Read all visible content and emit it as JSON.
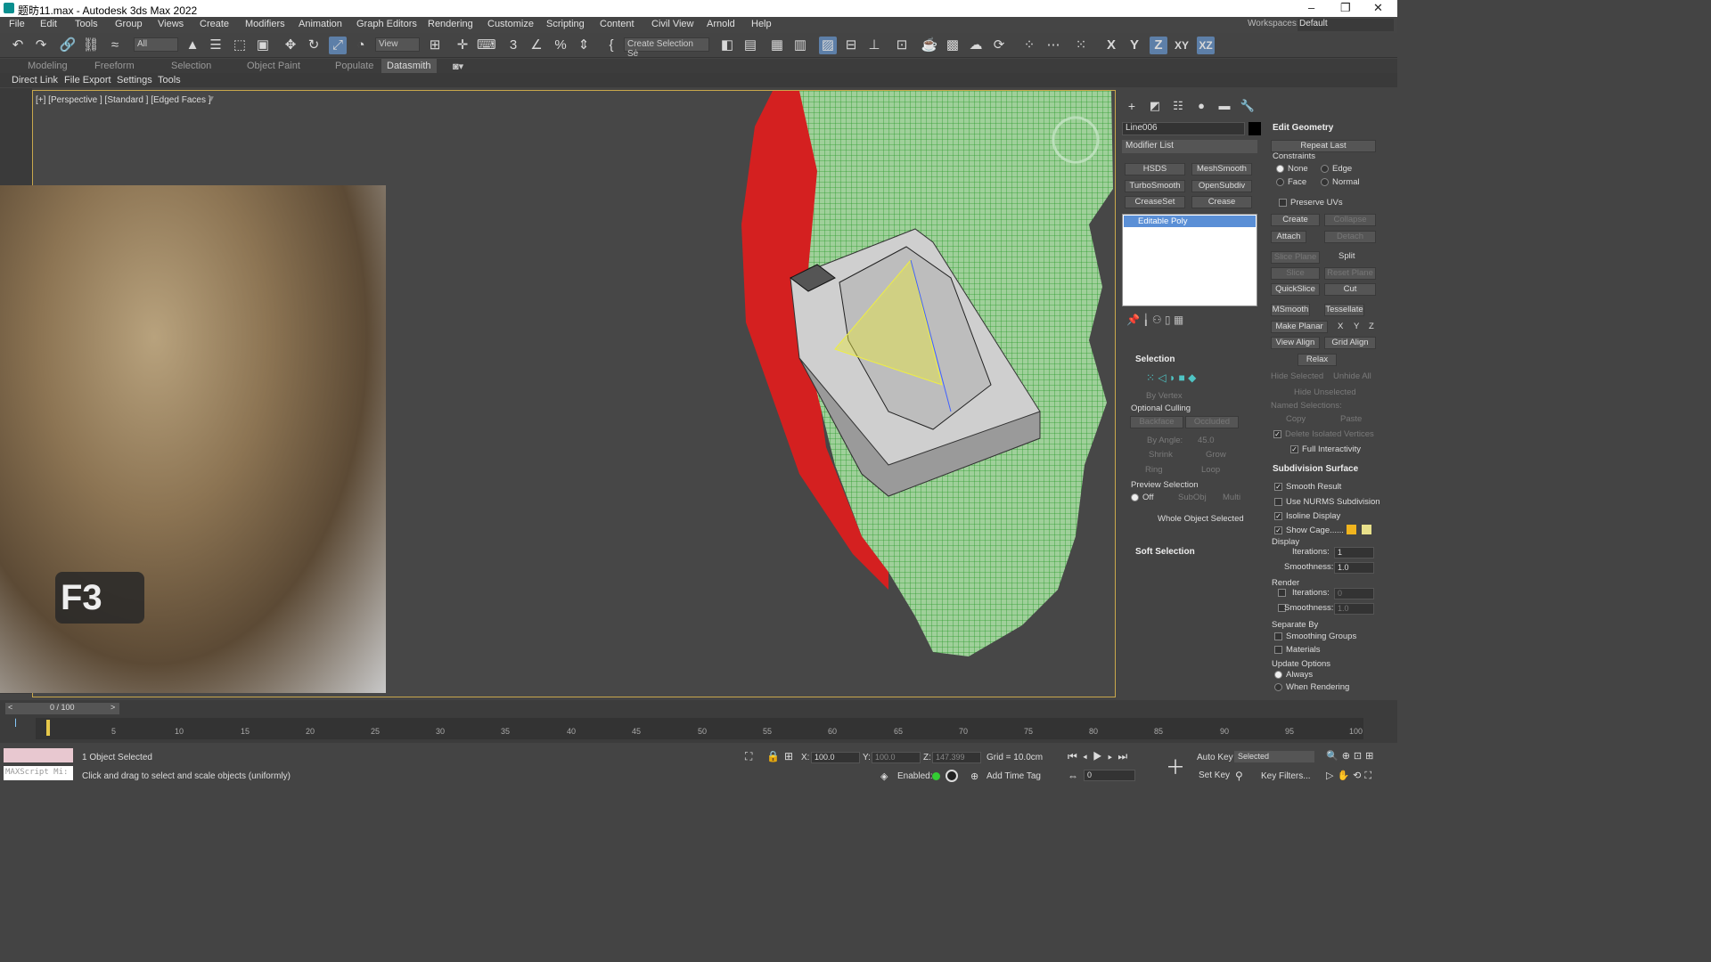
{
  "window": {
    "title": "题昉11.max - Autodesk 3ds Max 2022",
    "minimize": "–",
    "maximize": "❐",
    "close": "✕"
  },
  "menu": [
    "File",
    "Edit",
    "Tools",
    "Group",
    "Views",
    "Create",
    "Modifiers",
    "Animation",
    "Graph Editors",
    "Rendering",
    "Customize",
    "Scripting",
    "Content",
    "Civil View",
    "Arnold",
    "Help"
  ],
  "workspace": {
    "label": "Workspaces:",
    "value": "Default"
  },
  "toolbar": {
    "filter": "All",
    "refcoord": "View",
    "selset": "Create Selection Sė",
    "axes": [
      "X",
      "Y",
      "Z",
      "XY",
      "XZ"
    ]
  },
  "ribbon": {
    "tabs": [
      "Modeling",
      "Freeform",
      "Selection",
      "Object Paint",
      "Populate",
      "Datasmith"
    ],
    "subtabs": [
      "Direct Link",
      "File Export",
      "Settings",
      "Tools"
    ]
  },
  "viewport": {
    "label": "[+] [Perspective ] [Standard ] [Edged Faces ]",
    "overlay_key": "F3"
  },
  "modify": {
    "object_name": "Line006",
    "modifier_list": "Modifier List",
    "mod_buttons": [
      "HSDS",
      "MeshSmooth",
      "TurboSmooth",
      "OpenSubdiv",
      "CreaseSet",
      "Crease"
    ],
    "stack_item": "Editable Poly",
    "selection": {
      "title": "Selection",
      "by_vertex": "By Vertex",
      "ignore_backfacing": "Optional Culling",
      "backface": "Backface",
      "occluded": "Occluded",
      "by_angle": "By Angle:",
      "angle": "45.0",
      "shrink": "Shrink",
      "grow": "Grow",
      "ring": "Ring",
      "loop": "Loop",
      "preview": "Preview Selection",
      "off": "Off",
      "subobj": "SubObj",
      "multi": "Multi",
      "status": "Whole Object Selected"
    },
    "soft_selection": "Soft Selection",
    "edit_geometry": {
      "title": "Edit Geometry",
      "repeat_last": "Repeat Last",
      "constraints": "Constraints",
      "c_none": "None",
      "c_edge": "Edge",
      "c_face": "Face",
      "c_normal": "Normal",
      "preserve_uvs": "Preserve UVs",
      "create": "Create",
      "collapse": "Collapse",
      "attach": "Attach",
      "detach": "Detach",
      "slice_plane": "Slice Plane",
      "split": "Split",
      "slice": "Slice",
      "reset_plane": "Reset Plane",
      "quickslice": "QuickSlice",
      "cut": "Cut",
      "msmooth": "MSmooth",
      "tessellate": "Tessellate",
      "make_planar": "Make Planar",
      "x": "X",
      "y": "Y",
      "z": "Z",
      "view_align": "View Align",
      "grid_align": "Grid Align",
      "relax": "Relax",
      "hide_selected": "Hide Selected",
      "unhide_all": "Unhide All",
      "hide_unselected": "Hide Unselected",
      "named_sel": "Named Selections:",
      "copy": "Copy",
      "paste": "Paste",
      "delete_iso": "Delete Isolated Vertices",
      "full_inter": "Full Interactivity"
    },
    "subdivision": {
      "title": "Subdivision Surface",
      "smooth_result": "Smooth Result",
      "use_nurms": "Use NURMS Subdivision",
      "isoline": "Isoline Display",
      "show_cage": "Show Cage......",
      "display": "Display",
      "iterations": "Iterations:",
      "iter_val": "1",
      "smoothness": "Smoothness:",
      "smooth_val": "1.0",
      "render": "Render",
      "r_iter": "0",
      "r_smooth": "1.0",
      "separate_by": "Separate By",
      "smoothing_groups": "Smoothing Groups",
      "materials": "Materials",
      "update_options": "Update Options",
      "always": "Always",
      "when_rendering": "When Rendering"
    }
  },
  "timeline": {
    "frame": "0 / 100",
    "ticks": [
      "5",
      "10",
      "15",
      "20",
      "25",
      "30",
      "35",
      "40",
      "45",
      "50",
      "55",
      "60",
      "65",
      "70",
      "75",
      "80",
      "85",
      "90",
      "95",
      "100"
    ]
  },
  "status": {
    "selected": "1 Object Selected",
    "prompt": "Click and drag to select and scale objects (uniformly)",
    "maxscript": "MAXScript Mi:",
    "x_label": "X:",
    "x": "100.0",
    "y_label": "Y:",
    "y": "100.0",
    "z_label": "Z:",
    "z": "147.399",
    "grid": "Grid = 10.0cm",
    "enabled": "Enabled:",
    "add_time_tag": "Add Time Tag",
    "auto_key": "Auto Key",
    "set_key": "Set Key",
    "selected_mode": "Selected",
    "key_filters": "Key Filters...",
    "frame_val": "0"
  }
}
